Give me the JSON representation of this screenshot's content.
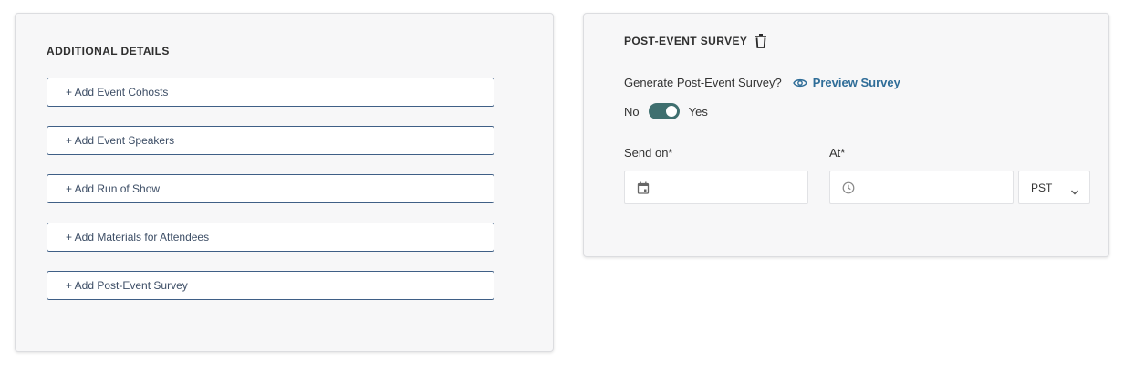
{
  "additional_details": {
    "title": "ADDITIONAL DETAILS",
    "buttons": [
      "+ Add Event Cohosts",
      "+ Add Event Speakers",
      "+ Add Run of Show",
      "+ Add Materials for Attendees",
      "+ Add Post-Event Survey"
    ]
  },
  "post_event_survey": {
    "title": "POST-EVENT SURVEY",
    "generate_label": "Generate Post-Event Survey?",
    "preview_label": "Preview Survey",
    "toggle": {
      "off_label": "No",
      "on_label": "Yes",
      "value": true
    },
    "send_on_label": "Send on*",
    "at_label": "At*",
    "send_on_value": "",
    "at_value": "",
    "timezone": "PST"
  },
  "icons": {
    "trash": "trash-icon",
    "eye": "eye-icon",
    "calendar": "calendar-icon",
    "clock": "clock-icon",
    "chevron": "chevron-down-icon"
  },
  "colors": {
    "button_border": "#3f5f86",
    "toggle_on": "#3f6f6f",
    "link": "#2f6d98",
    "card_bg": "#f7f7f8"
  }
}
